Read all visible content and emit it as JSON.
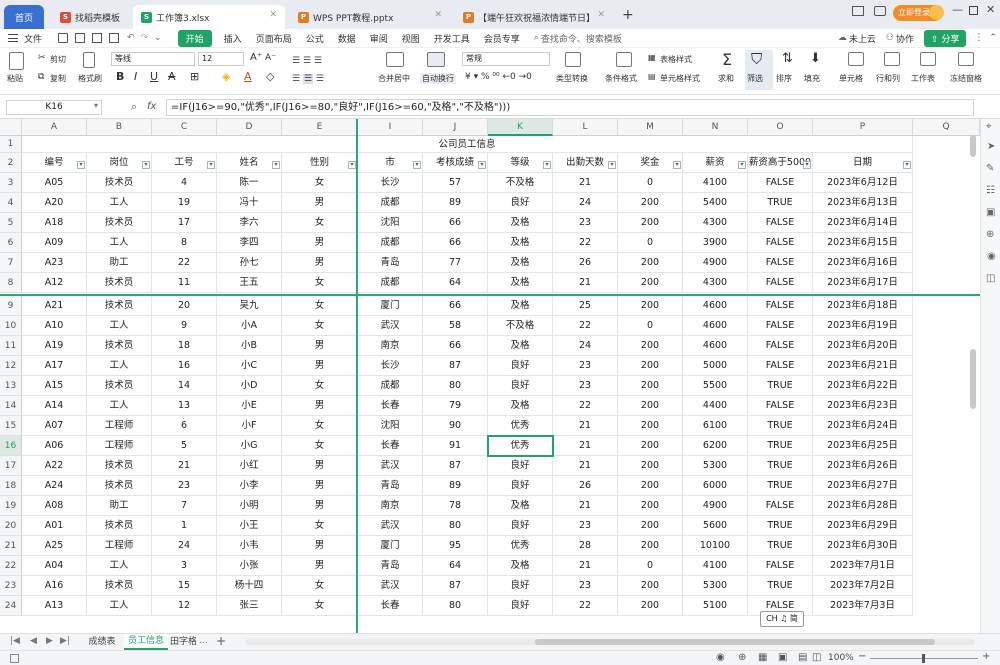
{
  "tabs": {
    "home": "首页",
    "t1": "找稻壳模板",
    "t2": "工作簿3.xlsx",
    "t3": "WPS PPT教程.pptx",
    "t4": "【端午狂欢祝福浓情端节日】",
    "login": "立即登录"
  },
  "menu": {
    "file": "文件",
    "items": [
      "开始",
      "插入",
      "页面布局",
      "公式",
      "数据",
      "审阅",
      "视图",
      "开发工具",
      "会员专享"
    ],
    "search": "查找命令、搜索模板",
    "cloud": "未上云",
    "collab": "协作",
    "share": "分享"
  },
  "ribbon": {
    "paste": "粘贴",
    "cut": "剪切",
    "copy": "复制",
    "format_painter": "格式刷",
    "font_name": "等线",
    "font_size": "12",
    "merge": "合并居中",
    "wrap": "自动换行",
    "number_format": "常规",
    "type_convert": "类型转换",
    "cond_format": "条件格式",
    "table_style": "表格样式",
    "cell_style": "单元格样式",
    "sum": "求和",
    "filter": "筛选",
    "sort": "排序",
    "fill": "填充",
    "cell": "单元格",
    "rowcol": "行和列",
    "sheet": "工作表",
    "freeze": "冻结窗格"
  },
  "formula_bar": {
    "name_box": "K16",
    "fx": "fx",
    "formula": "=IF(J16>=90,\"优秀\",IF(J16>=80,\"良好\",IF(J16>=60,\"及格\",\"不及格\")))"
  },
  "columns": [
    "A",
    "B",
    "C",
    "D",
    "E",
    "I",
    "J",
    "K",
    "L",
    "M",
    "N",
    "O",
    "P",
    "Q"
  ],
  "title": "公司员工信息",
  "headers": [
    "编号",
    "岗位",
    "工号",
    "姓名",
    "性别",
    "市",
    "考核成绩",
    "等级",
    "出勤天数",
    "奖金",
    "薪资",
    "薪资高于5000",
    "日期"
  ],
  "rows": [
    [
      "A05",
      "技术员",
      "4",
      "陈一",
      "女",
      "长沙",
      "57",
      "不及格",
      "21",
      "0",
      "4100",
      "FALSE",
      "2023年6月12日"
    ],
    [
      "A20",
      "工人",
      "19",
      "冯十",
      "男",
      "成都",
      "89",
      "良好",
      "24",
      "200",
      "5400",
      "TRUE",
      "2023年6月13日"
    ],
    [
      "A18",
      "技术员",
      "17",
      "李六",
      "女",
      "沈阳",
      "66",
      "及格",
      "23",
      "200",
      "4300",
      "FALSE",
      "2023年6月14日"
    ],
    [
      "A09",
      "工人",
      "8",
      "李四",
      "男",
      "成都",
      "66",
      "及格",
      "22",
      "0",
      "3900",
      "FALSE",
      "2023年6月15日"
    ],
    [
      "A23",
      "助工",
      "22",
      "孙七",
      "男",
      "青岛",
      "77",
      "及格",
      "26",
      "200",
      "4900",
      "FALSE",
      "2023年6月16日"
    ],
    [
      "A12",
      "技术员",
      "11",
      "王五",
      "女",
      "成都",
      "64",
      "及格",
      "21",
      "200",
      "4300",
      "FALSE",
      "2023年6月17日"
    ],
    [
      "A21",
      "技术员",
      "20",
      "吴九",
      "女",
      "厦门",
      "66",
      "及格",
      "25",
      "200",
      "4600",
      "FALSE",
      "2023年6月18日"
    ],
    [
      "A10",
      "工人",
      "9",
      "小A",
      "女",
      "武汉",
      "58",
      "不及格",
      "22",
      "0",
      "4600",
      "FALSE",
      "2023年6月19日"
    ],
    [
      "A19",
      "技术员",
      "18",
      "小B",
      "男",
      "南京",
      "66",
      "及格",
      "24",
      "200",
      "4600",
      "FALSE",
      "2023年6月20日"
    ],
    [
      "A17",
      "工人",
      "16",
      "小C",
      "男",
      "长沙",
      "87",
      "良好",
      "23",
      "200",
      "5000",
      "FALSE",
      "2023年6月21日"
    ],
    [
      "A15",
      "技术员",
      "14",
      "小D",
      "女",
      "成都",
      "80",
      "良好",
      "23",
      "200",
      "5500",
      "TRUE",
      "2023年6月22日"
    ],
    [
      "A14",
      "工人",
      "13",
      "小E",
      "男",
      "长春",
      "79",
      "及格",
      "22",
      "200",
      "4400",
      "FALSE",
      "2023年6月23日"
    ],
    [
      "A07",
      "工程师",
      "6",
      "小F",
      "女",
      "沈阳",
      "90",
      "优秀",
      "21",
      "200",
      "6100",
      "TRUE",
      "2023年6月24日"
    ],
    [
      "A06",
      "工程师",
      "5",
      "小G",
      "女",
      "长春",
      "91",
      "优秀",
      "21",
      "200",
      "6200",
      "TRUE",
      "2023年6月25日"
    ],
    [
      "A22",
      "技术员",
      "21",
      "小红",
      "男",
      "武汉",
      "87",
      "良好",
      "21",
      "200",
      "5300",
      "TRUE",
      "2023年6月26日"
    ],
    [
      "A24",
      "技术员",
      "23",
      "小李",
      "男",
      "青岛",
      "89",
      "良好",
      "26",
      "200",
      "6000",
      "TRUE",
      "2023年6月27日"
    ],
    [
      "A08",
      "助工",
      "7",
      "小明",
      "男",
      "南京",
      "78",
      "及格",
      "21",
      "200",
      "4900",
      "FALSE",
      "2023年6月28日"
    ],
    [
      "A01",
      "技术员",
      "1",
      "小王",
      "女",
      "武汉",
      "80",
      "良好",
      "23",
      "200",
      "5600",
      "TRUE",
      "2023年6月29日"
    ],
    [
      "A25",
      "工程师",
      "24",
      "小韦",
      "男",
      "厦门",
      "95",
      "优秀",
      "28",
      "200",
      "10100",
      "TRUE",
      "2023年6月30日"
    ],
    [
      "A04",
      "工人",
      "3",
      "小张",
      "男",
      "青岛",
      "64",
      "及格",
      "21",
      "0",
      "4100",
      "FALSE",
      "2023年7月1日"
    ],
    [
      "A16",
      "技术员",
      "15",
      "杨十四",
      "女",
      "武汉",
      "87",
      "良好",
      "23",
      "200",
      "5300",
      "TRUE",
      "2023年7月2日"
    ],
    [
      "A13",
      "工人",
      "12",
      "张三",
      "女",
      "长春",
      "80",
      "良好",
      "22",
      "200",
      "5100",
      "FALSE",
      "2023年7月3日"
    ]
  ],
  "row_numbers": [
    "1",
    "2",
    "3",
    "4",
    "5",
    "6",
    "7",
    "8",
    "9",
    "10",
    "11",
    "12",
    "13",
    "14",
    "15",
    "16",
    "17",
    "18",
    "19",
    "20",
    "21",
    "22",
    "23",
    "24"
  ],
  "sheets": [
    "成绩表",
    "员工信息",
    "田字格"
  ],
  "ime": "CH ♫ 简",
  "zoom": "100%",
  "colors": {
    "accent": "#21a366",
    "wps_green": "#28a745",
    "freeze_line": "#2aa876"
  }
}
